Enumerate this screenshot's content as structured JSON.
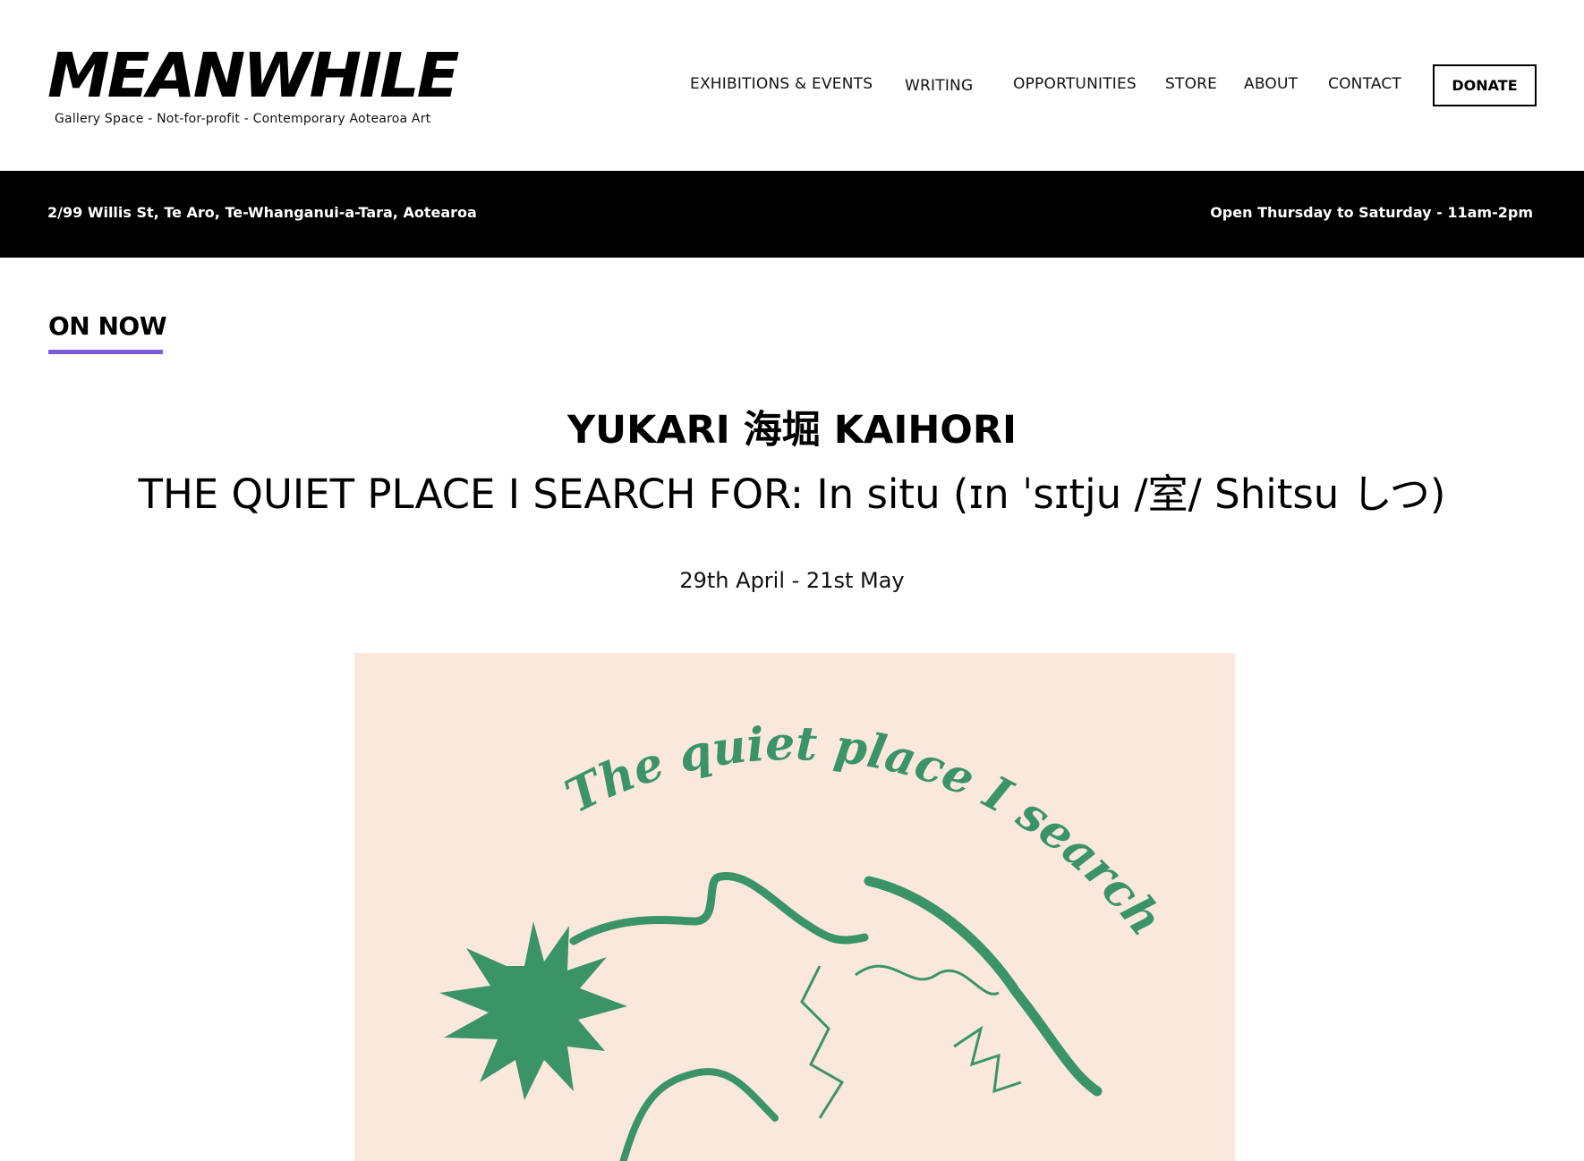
{
  "header": {
    "logo_text": "MEANWHILE",
    "tagline": "Gallery Space  -  Not-for-profit  -  Contemporary Aotearoa Art",
    "nav": {
      "exhibitions": "EXHIBITIONS & EVENTS",
      "writing": "WRITING",
      "opportunities": "OPPORTUNITIES",
      "store": "STORE",
      "about": "ABOUT",
      "contact": "CONTACT",
      "donate": "DONATE"
    }
  },
  "info_bar": {
    "address": "2/99 Willis St, Te Aro, Te-Whanganui-a-Tara, Aotearoa",
    "hours": "Open Thursday to Saturday  -  11am-2pm"
  },
  "main": {
    "section_heading": "ON NOW",
    "artist": "YUKARI 海堀 KAIHORI",
    "title": "THE QUIET PLACE I SEARCH FOR: In situ (ɪn ˈsɪtju /室/ Shitsu しつ)",
    "dates": "29th April - 21st May"
  },
  "poster": {
    "text": "The quiet place I search for:",
    "background_color": "#fbe8dc",
    "ink_color": "#3a9468"
  },
  "colors": {
    "accent_underline": "#7b5cd6",
    "info_bar_bg": "#000000"
  }
}
